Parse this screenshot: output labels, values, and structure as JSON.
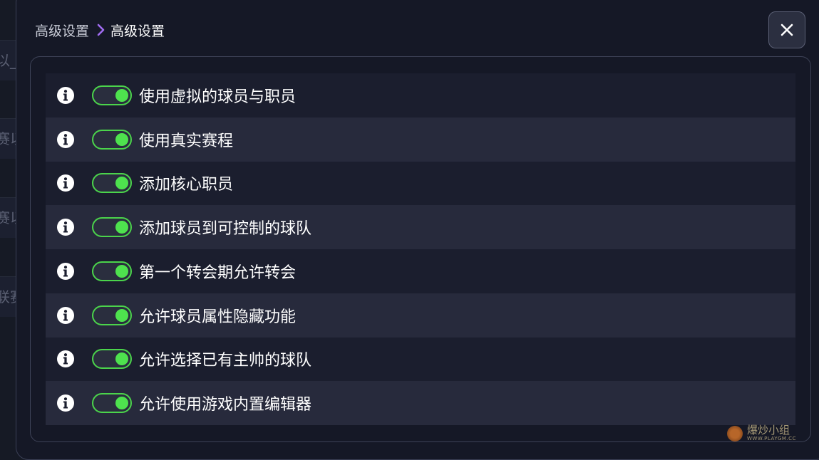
{
  "background_stubs": [
    "以_",
    "赛以",
    "赛以",
    "联赛"
  ],
  "breadcrumb": {
    "parent": "高级设置",
    "current": "高级设置"
  },
  "close_button": {
    "icon": "close-icon"
  },
  "settings": [
    {
      "label": "使用虚拟的球员与职员",
      "enabled": true
    },
    {
      "label": "使用真实赛程",
      "enabled": true
    },
    {
      "label": "添加核心职员",
      "enabled": true
    },
    {
      "label": "添加球员到可控制的球队",
      "enabled": true
    },
    {
      "label": "第一个转会期允许转会",
      "enabled": true
    },
    {
      "label": "允许球员属性隐藏功能",
      "enabled": true
    },
    {
      "label": "允许选择已有主帅的球队",
      "enabled": true
    },
    {
      "label": "允许使用游戏内置编辑器",
      "enabled": true
    }
  ],
  "watermark": {
    "title": "爆炒小组",
    "subtitle": "WWW.PLAYGM.CC"
  },
  "colors": {
    "toggle_on": "#4ee24e",
    "breadcrumb_chevron": "#a06cf0",
    "row_dark": "#1b1e2e",
    "row_light": "#272a3c"
  }
}
